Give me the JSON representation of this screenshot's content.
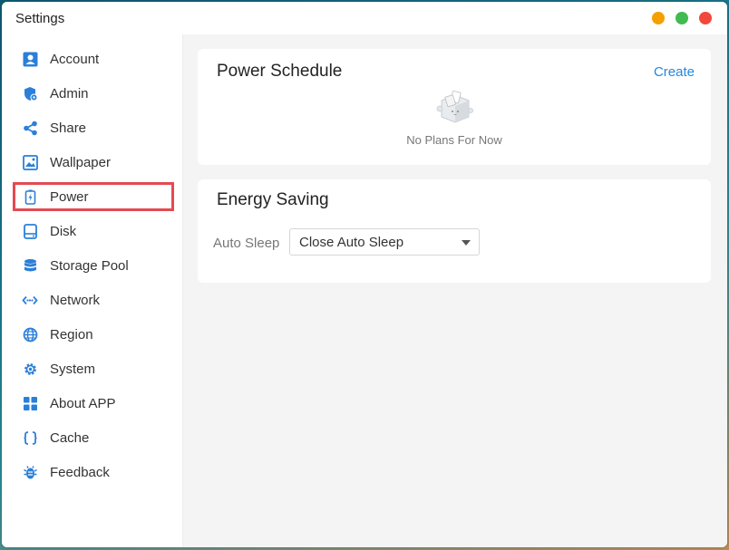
{
  "window": {
    "title": "Settings"
  },
  "sidebar": {
    "items": [
      {
        "label": "Account",
        "icon": "account-icon"
      },
      {
        "label": "Admin",
        "icon": "admin-shield-icon"
      },
      {
        "label": "Share",
        "icon": "share-icon"
      },
      {
        "label": "Wallpaper",
        "icon": "wallpaper-icon"
      },
      {
        "label": "Power",
        "icon": "power-battery-icon",
        "active": true
      },
      {
        "label": "Disk",
        "icon": "disk-icon"
      },
      {
        "label": "Storage Pool",
        "icon": "storage-pool-icon"
      },
      {
        "label": "Network",
        "icon": "network-icon"
      },
      {
        "label": "Region",
        "icon": "globe-icon"
      },
      {
        "label": "System",
        "icon": "gear-icon"
      },
      {
        "label": "About APP",
        "icon": "grid-icon"
      },
      {
        "label": "Cache",
        "icon": "braces-icon"
      },
      {
        "label": "Feedback",
        "icon": "bug-icon"
      }
    ]
  },
  "power_schedule": {
    "title": "Power Schedule",
    "create_label": "Create",
    "empty_text": "No Plans For Now"
  },
  "energy_saving": {
    "title": "Energy Saving",
    "auto_sleep_label": "Auto Sleep",
    "auto_sleep_value": "Close Auto Sleep"
  },
  "colors": {
    "accent": "#2088e0",
    "nav_icon": "#2b7fd8",
    "highlight_border": "#e44a52",
    "traffic_min": "#f5a000",
    "traffic_max": "#41bb50",
    "traffic_close": "#f2473b"
  }
}
